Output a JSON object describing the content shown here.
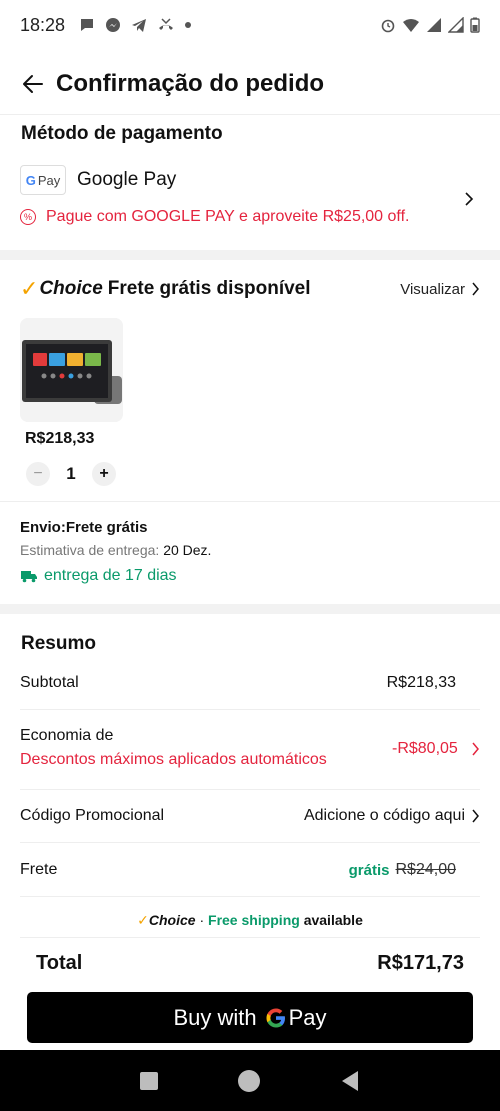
{
  "status_bar": {
    "time": "18:28"
  },
  "header": {
    "title": "Confirmação do pedido"
  },
  "payment": {
    "section_title": "Método de pagamento",
    "badge_text": "Pay",
    "method_name": "Google Pay",
    "promo_text": "Pague com GOOGLE PAY e aproveite R$25,00 off."
  },
  "choice": {
    "choice_word": "Choice",
    "free_text": "Frete grátis disponível",
    "view_label": "Visualizar"
  },
  "product": {
    "price": "R$218,33",
    "quantity": "1",
    "minus": "−",
    "plus": "+"
  },
  "shipping": {
    "envio": "Envio:Frete grátis",
    "estimate_label": "Estimativa de entrega:",
    "estimate_date": "20 Dez.",
    "delivery": "entrega de 17 dias"
  },
  "summary": {
    "title": "Resumo",
    "subtotal_label": "Subtotal",
    "subtotal_value": "R$218,33",
    "economia_label": "Economia de",
    "economia_sub": "Descontos máximos aplicados automáticos",
    "economia_value": "-R$80,05",
    "promo_label": "Código Promocional",
    "promo_value": "Adicione o código aqui",
    "frete_label": "Frete",
    "frete_free": "grátis",
    "frete_old": "R$24,00"
  },
  "availability": {
    "choice_word": "Choice",
    "dot": "·",
    "free_shipping": "Free shipping",
    "available": "available"
  },
  "total": {
    "label": "Total",
    "value": "R$171,73"
  },
  "buy_button": {
    "prefix": "Buy with",
    "pay_word": "Pay"
  },
  "colors": {
    "accent_red": "#e4243e",
    "green": "#0a9a6a",
    "choice_orange": "#f4a300"
  }
}
